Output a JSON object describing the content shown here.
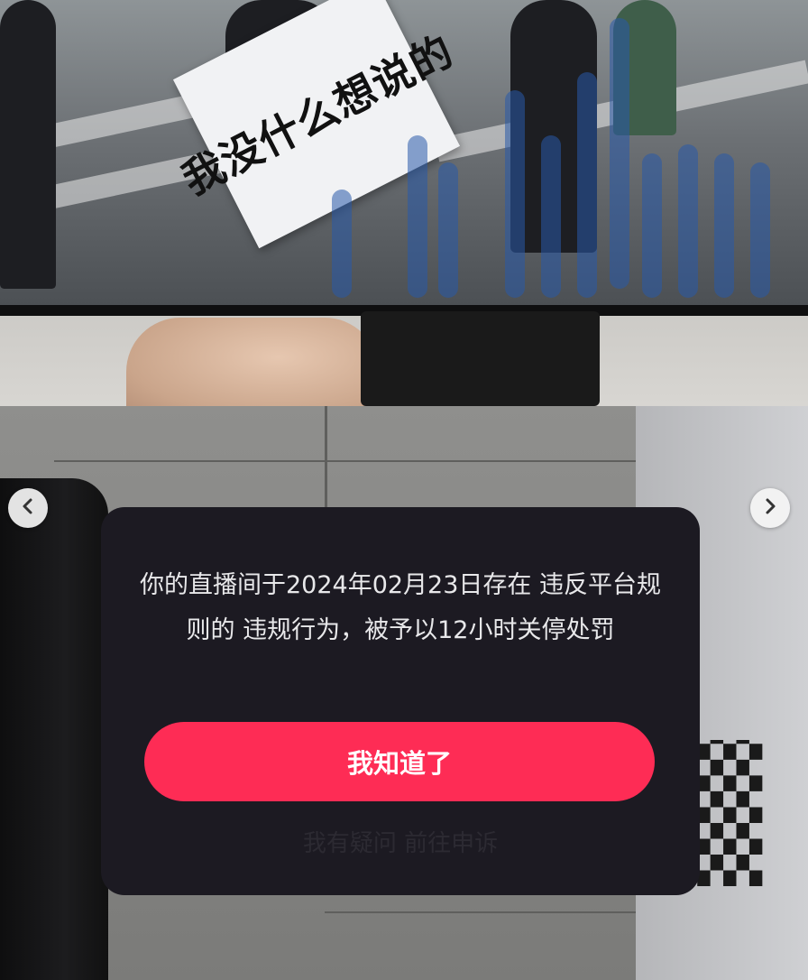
{
  "photo_top": {
    "sign_text": "我没什么想说的"
  },
  "carousel": {
    "prev_icon": "chevron-left-icon",
    "next_icon": "chevron-right-icon"
  },
  "dialog": {
    "message": "你的直播间于2024年02月23日存在 违反平台规则的 违规行为，被予以12小时关停处罚",
    "primary_button": "我知道了",
    "appeal_link": "我有疑问 前往申诉"
  },
  "colors": {
    "dialog_bg": "#1c1a22",
    "primary_button": "#fe2c55",
    "message_text": "#e8e8ea"
  }
}
